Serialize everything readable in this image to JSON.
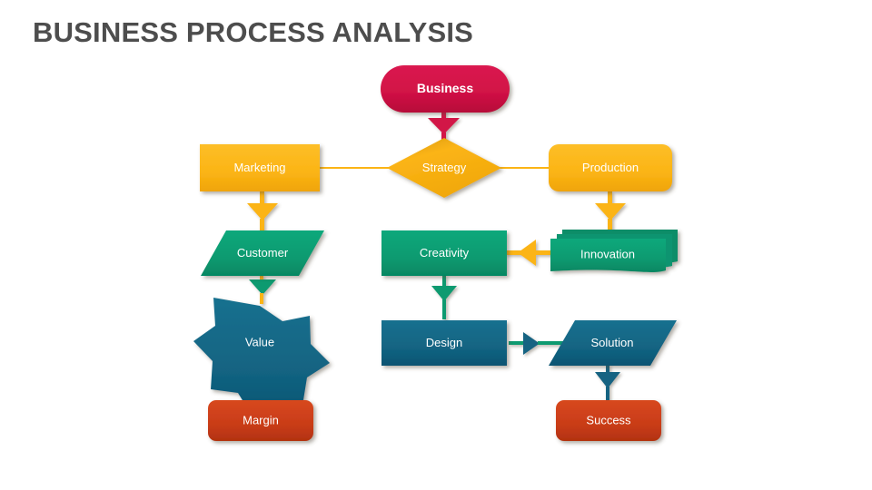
{
  "slide": {
    "title": "BUSINESS PROCESS ANALYSIS",
    "background_color": "#ffffff",
    "title_color": "#4d4d4d"
  },
  "palette": {
    "crimson": "#D21246",
    "gold": "#FBB415",
    "green": "#0A9A70",
    "teal": "#126482",
    "orange_red": "#C93C18",
    "label_text": "#ffffff"
  },
  "diagram": {
    "type": "flowchart",
    "nodes": [
      {
        "id": "business",
        "label": "Business",
        "shape": "rounded-pill",
        "color": "#D21246",
        "row": 0,
        "column": "center"
      },
      {
        "id": "marketing",
        "label": "Marketing",
        "shape": "rectangle",
        "color": "#FBB415",
        "row": 1,
        "column": "left"
      },
      {
        "id": "strategy",
        "label": "Strategy",
        "shape": "diamond",
        "color": "#FBB415",
        "row": 1,
        "column": "center"
      },
      {
        "id": "production",
        "label": "Production",
        "shape": "rounded-rectangle",
        "color": "#FBB415",
        "row": 1,
        "column": "right"
      },
      {
        "id": "customer",
        "label": "Customer",
        "shape": "parallelogram",
        "color": "#0A9A70",
        "row": 2,
        "column": "left"
      },
      {
        "id": "creativity",
        "label": "Creativity",
        "shape": "rectangle",
        "color": "#0A9A70",
        "row": 2,
        "column": "center"
      },
      {
        "id": "innovation",
        "label": "Innovation",
        "shape": "multi-document",
        "color": "#0A9A70",
        "row": 2,
        "column": "right"
      },
      {
        "id": "value",
        "label": "Value",
        "shape": "seven-point-star",
        "color": "#126482",
        "row": 3,
        "column": "left"
      },
      {
        "id": "design",
        "label": "Design",
        "shape": "rectangle",
        "color": "#126482",
        "row": 3,
        "column": "center"
      },
      {
        "id": "solution",
        "label": "Solution",
        "shape": "parallelogram",
        "color": "#126482",
        "row": 3,
        "column": "right"
      },
      {
        "id": "margin",
        "label": "Margin",
        "shape": "rounded-rectangle",
        "color": "#C93C18",
        "row": 4,
        "column": "left"
      },
      {
        "id": "success",
        "label": "Success",
        "shape": "rounded-rectangle",
        "color": "#C93C18",
        "row": 4,
        "column": "right"
      }
    ],
    "connectors": [
      {
        "id": "business-to-strategy",
        "from": "business",
        "to": "strategy",
        "direction": "down",
        "color": "#D21246",
        "arrow": true
      },
      {
        "id": "marketing-to-strategy",
        "from": "marketing",
        "to": "strategy",
        "direction": "right",
        "color": "#FBB415",
        "arrow": false
      },
      {
        "id": "strategy-to-production",
        "from": "strategy",
        "to": "production",
        "direction": "right",
        "color": "#FBB415",
        "arrow": false
      },
      {
        "id": "marketing-to-customer",
        "from": "marketing",
        "to": "customer",
        "direction": "down",
        "color": "#FBB415",
        "arrow": true
      },
      {
        "id": "production-to-innovation",
        "from": "production",
        "to": "innovation",
        "direction": "down",
        "color": "#FBB415",
        "arrow": true
      },
      {
        "id": "innovation-to-creativity",
        "from": "innovation",
        "to": "creativity",
        "direction": "left",
        "color": "#FBB415",
        "arrow": true
      },
      {
        "id": "customer-to-value",
        "from": "customer",
        "to": "value",
        "direction": "down",
        "color": "#0A9A70",
        "arrow": true
      },
      {
        "id": "creativity-to-design",
        "from": "creativity",
        "to": "design",
        "direction": "down",
        "color": "#0A9A70",
        "arrow": true
      },
      {
        "id": "design-to-solution",
        "from": "design",
        "to": "solution",
        "direction": "right",
        "color": "#0A9A70",
        "arrow": true
      },
      {
        "id": "value-to-margin",
        "from": "value",
        "to": "margin",
        "direction": "down",
        "color": "#126482",
        "arrow": true
      },
      {
        "id": "solution-to-success",
        "from": "solution",
        "to": "success",
        "direction": "down",
        "color": "#126482",
        "arrow": true
      }
    ]
  }
}
